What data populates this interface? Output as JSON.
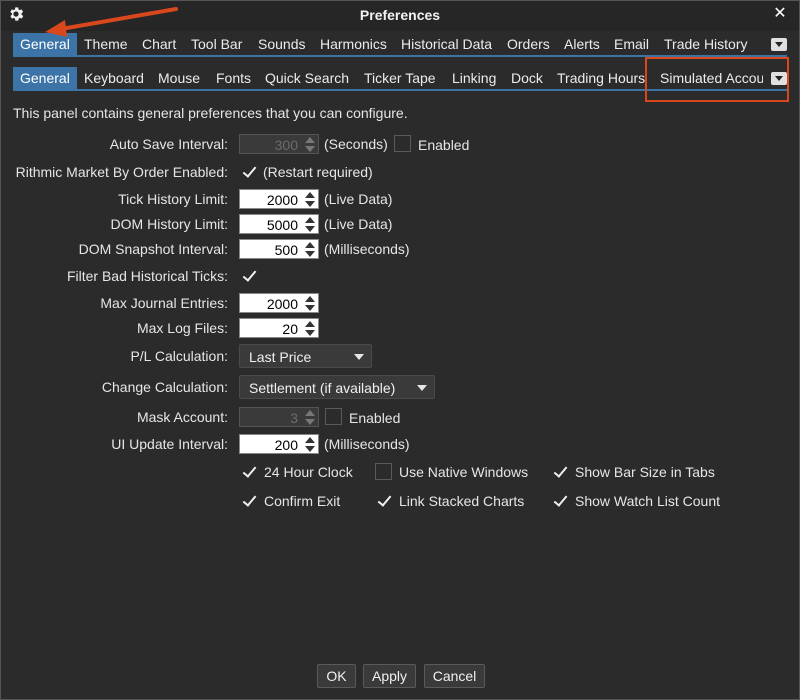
{
  "window": {
    "title": "Preferences"
  },
  "tabs_top": [
    {
      "label": "General",
      "active": true
    },
    {
      "label": "Theme"
    },
    {
      "label": "Chart"
    },
    {
      "label": "Tool Bar"
    },
    {
      "label": "Sounds"
    },
    {
      "label": "Harmonics"
    },
    {
      "label": "Historical Data"
    },
    {
      "label": "Orders"
    },
    {
      "label": "Alerts"
    },
    {
      "label": "Email"
    },
    {
      "label": "Trade History"
    }
  ],
  "tabs_sub": [
    {
      "label": "General",
      "active": true
    },
    {
      "label": "Keyboard"
    },
    {
      "label": "Mouse"
    },
    {
      "label": "Fonts"
    },
    {
      "label": "Quick Search"
    },
    {
      "label": "Ticker Tape"
    },
    {
      "label": "Linking"
    },
    {
      "label": "Dock"
    },
    {
      "label": "Trading Hours"
    },
    {
      "label": "Simulated Accou"
    }
  ],
  "description": "This panel contains general preferences that you can configure.",
  "fields": {
    "auto_save": {
      "label": "Auto Save Interval:",
      "value": "300",
      "unit": "(Seconds)",
      "enabled_label": "Enabled",
      "enabled": false
    },
    "rithmic": {
      "label": "Rithmic Market By Order Enabled:",
      "checked": true,
      "note": "(Restart required)"
    },
    "tick_history": {
      "label": "Tick History Limit:",
      "value": "2000",
      "unit": "(Live Data)"
    },
    "dom_history": {
      "label": "DOM History Limit:",
      "value": "5000",
      "unit": "(Live Data)"
    },
    "dom_snapshot": {
      "label": "DOM Snapshot Interval:",
      "value": "500",
      "unit": "(Milliseconds)"
    },
    "filter_bad": {
      "label": "Filter Bad Historical Ticks:",
      "checked": true
    },
    "max_journal": {
      "label": "Max Journal Entries:",
      "value": "2000"
    },
    "max_log": {
      "label": "Max Log Files:",
      "value": "20"
    },
    "pl_calc": {
      "label": "P/L Calculation:",
      "value": "Last Price"
    },
    "change_calc": {
      "label": "Change Calculation:",
      "value": "Settlement (if available)"
    },
    "mask_account": {
      "label": "Mask Account:",
      "value": "3",
      "enabled_label": "Enabled",
      "enabled": false
    },
    "ui_update": {
      "label": "UI Update Interval:",
      "value": "200",
      "unit": "(Milliseconds)"
    }
  },
  "options": [
    {
      "label": "24 Hour Clock",
      "checked": true
    },
    {
      "label": "Use Native Windows",
      "checked": false
    },
    {
      "label": "Show Bar Size in Tabs",
      "checked": true
    },
    {
      "label": "Confirm Exit",
      "checked": true
    },
    {
      "label": "Link Stacked Charts",
      "checked": true
    },
    {
      "label": "Show Watch List Count",
      "checked": true
    }
  ],
  "buttons": {
    "ok": "OK",
    "apply": "Apply",
    "cancel": "Cancel"
  },
  "icons": {
    "settings": "gear-icon",
    "close": "close-icon"
  },
  "colors": {
    "accent": "#3c74a8",
    "annotation": "#d9481c",
    "background": "#2b2b2b"
  }
}
